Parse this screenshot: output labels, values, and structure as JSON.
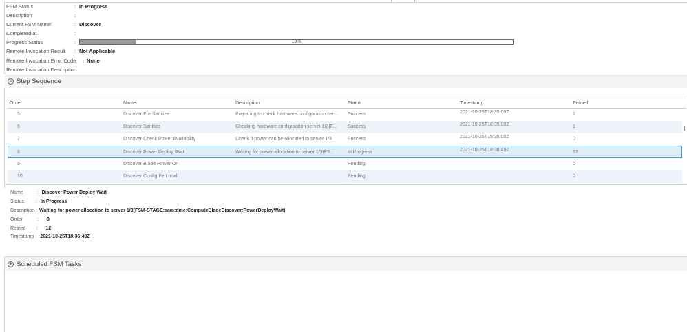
{
  "properties": {
    "fsm_status": {
      "label": "FSM Status",
      "value": "In Progress"
    },
    "description": {
      "label": "Description",
      "value": ""
    },
    "current_fsm_name": {
      "label": "Current FSM Name",
      "value": "Discover"
    },
    "completed_at": {
      "label": "Completed at",
      "value": ""
    },
    "progress_status": {
      "label": "Progress Status",
      "value": 0.13,
      "text": "13%"
    },
    "remote_invocation_result": {
      "label": "Remote Invocation Result",
      "value": "Not Applicable"
    },
    "remote_invocation_error_code": {
      "label": "Remote Invocation Error Code",
      "value": "None"
    },
    "remote_invocation_description": {
      "label": "Remote Invocation Description",
      "value": ""
    }
  },
  "step_sequence": {
    "title": "Step Sequence",
    "icon": "collapse-circle-icon",
    "columns": [
      "Order",
      "Name",
      "Description",
      "Status",
      "Timestamp",
      "Retried"
    ],
    "rows": [
      {
        "order": "5",
        "name": "Discover Pre Sanitize",
        "description": "Preparing to check hardware configuration ser...",
        "status": "Success",
        "timestamp": "2021-10-25T18:35:00Z",
        "retried": "1"
      },
      {
        "order": "6",
        "name": "Discover Sanitize",
        "description": "Checking hardware configuration server 1/3(F...",
        "status": "Success",
        "timestamp": "2021-10-25T18:35:00Z",
        "retried": "1"
      },
      {
        "order": "7",
        "name": "Discover Check Power Availability",
        "description": "Check if power can be allocated to server 1/3...",
        "status": "Success",
        "timestamp": "2021-10-25T18:35:00Z",
        "retried": "0"
      },
      {
        "order": "8",
        "name": "Discover Power Deploy Wait",
        "description": "Waiting for power allocation to server 1/3(FS...",
        "status": "In Progress",
        "timestamp": "2021-10-25T18:36:49Z",
        "retried": "12"
      },
      {
        "order": "9",
        "name": "Discover Blade Power On",
        "description": "",
        "status": "Pending",
        "timestamp": "",
        "retried": "0"
      },
      {
        "order": "10",
        "name": "Discover Config Fe Local",
        "description": "",
        "status": "Pending",
        "timestamp": "",
        "retried": "0"
      }
    ]
  },
  "splitter": {
    "text": "....."
  },
  "details": {
    "name": {
      "label": "Name",
      "value": "Discover Power Deploy Wait"
    },
    "status": {
      "label": "Status",
      "value": "In Progress"
    },
    "description": {
      "label": "Description",
      "value": "Waiting for power allocation to server 1/3(FSM-STAGE:sam:dme:ComputeBladeDiscover:PowerDeployWait)"
    },
    "order": {
      "label": "Order",
      "value": "8"
    },
    "retried": {
      "label": "Retried",
      "value": "12"
    },
    "timestamp": {
      "label": "Timestamp",
      "value": "2021-10-25T18:36:49Z"
    }
  },
  "scheduled_fsm_tasks": {
    "title": "Scheduled FSM Tasks",
    "icon": "expand-circle-icon"
  },
  "colors": {
    "selected_row_border": "#3b9bcf",
    "selected_row_bg": "#ddeef7",
    "alt_row_bg": "#eef3f9",
    "progress_fill": "#9a9a9a"
  }
}
